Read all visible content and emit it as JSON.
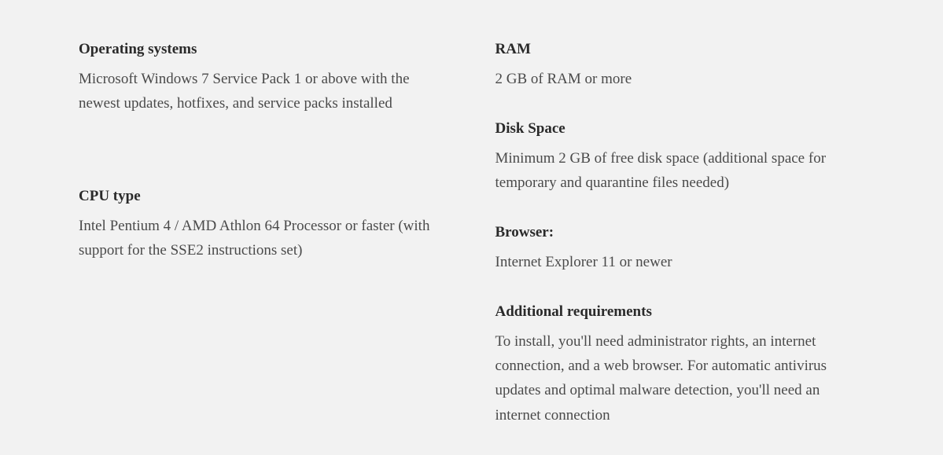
{
  "left": {
    "os": {
      "heading": "Operating systems",
      "body": "Microsoft Windows 7 Service Pack 1 or above with the newest updates, hotfixes, and service packs installed"
    },
    "cpu": {
      "heading": "CPU type",
      "body": "Intel Pentium 4 / AMD Athlon 64 Processor or faster (with support for the SSE2 instructions set)"
    }
  },
  "right": {
    "ram": {
      "heading": "RAM",
      "body": "2 GB of RAM or more"
    },
    "disk": {
      "heading": "Disk Space",
      "body": "Minimum 2 GB of free disk space (additional space for temporary and quarantine files needed)"
    },
    "browser": {
      "heading": "Browser:",
      "body": "Internet Explorer 11 or newer"
    },
    "additional": {
      "heading": "Additional requirements",
      "body": "To install, you'll need administrator rights, an internet connection, and a web browser. For automatic antivirus updates and optimal malware detection, you'll need an internet connection"
    }
  }
}
